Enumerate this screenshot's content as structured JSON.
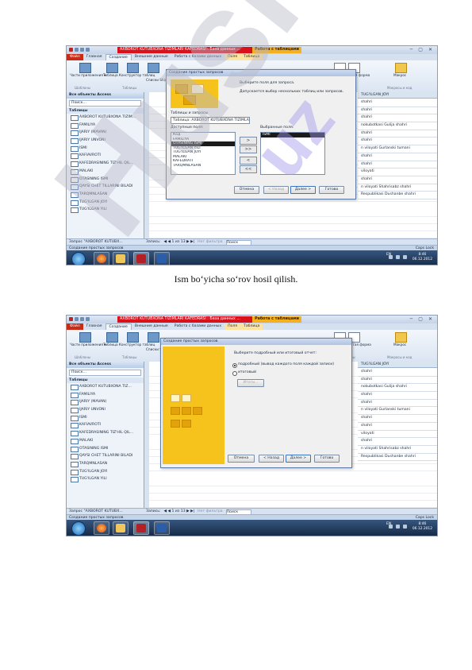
{
  "caption": "Ism bo‘yicha so‘rov hosil qilish.",
  "watermark": "Husnot",
  "watermark2": "uz",
  "shot1": {
    "title": "AXBOROT KUTUBXONA TIZIMLARI KAFEDRASI : База данных ...",
    "context_tab": "Работа с таблицами",
    "window_controls": [
      "─",
      "▢",
      "✕"
    ],
    "tabs": [
      "Файл",
      "Главная",
      "Создание",
      "Внешние данные",
      "Работа с базами данных",
      "Поля",
      "Таблица"
    ],
    "ribbon": {
      "b1": "Части приложения ▾",
      "b2": "Таблица Конструктор таблиц",
      "b3": "Списки SharePoint",
      "g1": "Шаблоны",
      "g2": "Таблицы",
      "b4": "Форма Пустая форма",
      "b5": "Макрос",
      "g3": "Формы",
      "g4": "Макросы и код"
    },
    "nav": {
      "header": "Все объекты Access",
      "search": "Поиск...",
      "section": "Таблицы",
      "items": [
        "AXBOROT KUTUBXONA TIZIM...",
        "FAMILIYA",
        "IJARIY (MAVAN)",
        "IJARIY UNVONI",
        "ISMI",
        "KAFIAVROTI",
        "KAFEDRASINING TIZ'HIL QIL...",
        "MALAKI",
        "OTASINING ISMI",
        "QAYSI CHET TILLARINI BILADI",
        "TARQMNLASAN",
        "TUG'ILGAN JOYI",
        "TUG'ILGAN YILI"
      ],
      "footer": "Запрос \"AXBOROT KUTUBX..."
    },
    "column_header": "TUG'ILGAN JOYI",
    "right_column": [
      "shahri",
      "shahri",
      "shahri",
      "nokubotkasi Gulija shahri",
      "shahri",
      "shahri",
      "n viloyati Gurlanski tumani",
      "shahri",
      "shahri",
      "viloyati",
      "shahri",
      "n viloyati Shahrisabz shahri",
      "Respublikasi Dushanbe shahri"
    ],
    "record_nav": {
      "label": "Запись:",
      "pos": "◀ ◀ 1 из 13 ▶ ▶|",
      "filter": "Нет фильтра",
      "search": "Поиск"
    },
    "status": "Создание простых запросов",
    "status_right": "Caps Lock",
    "clock": {
      "time": "8:46",
      "date": "06.12.2012"
    },
    "tray_lang": "EN",
    "dialog": {
      "title": "Создание простых запросов",
      "prompt1": "Выберите поля для запроса.",
      "prompt2": "Допускается выбор нескольких таблиц или запросов.",
      "tables_label": "Таблицы и запросы",
      "table_value": "Таблица: AXBOROT KUTUBXONA TIZIMLARI KAFEDRASI",
      "avail_label": "Доступные поля:",
      "avail_fields": [
        "Код",
        "FAMILIYA",
        "OTASINING ISMI",
        "TUG'ILGAN YILI",
        "TUG'ILGAN JOYI",
        "MALAKI",
        "KAFEDRATI",
        "TARQMNLASAN"
      ],
      "selected_label": "Выбранные поля:",
      "selected_fields": [
        "ISMI"
      ],
      "arrows": [
        ">",
        ">>",
        "<",
        "<<"
      ],
      "buttons": [
        "Отмена",
        "< Назад",
        "Далее >",
        "Готово"
      ]
    }
  },
  "shot2": {
    "title": "AXBOROT KUTUBXONA TIZIMLARI KAFEDRASI : База данных ...",
    "context_tab": "Работа с таблицами",
    "window_controls": [
      "─",
      "▢",
      "✕"
    ],
    "tabs": [
      "Файл",
      "Главная",
      "Создание",
      "Внешние данные",
      "Работа с базами данных",
      "Поля",
      "Таблица"
    ],
    "ribbon": {
      "b1": "Части приложения ▾",
      "b2": "Таблица Конструктор таблиц",
      "b3": "Списки SharePoint",
      "g1": "Шаблоны",
      "g2": "Таблицы",
      "b4": "Мастер Пустая форма",
      "b5": "Макрос",
      "g3": "Формы",
      "g4": "Макросы и код"
    },
    "nav": {
      "header": "Все объекты Access",
      "search": "Поиск...",
      "section": "Таблицы",
      "items": [
        "AXBOROT KUTUBXONA TIZ...",
        "FAMILIYA",
        "IJARIY (MAVAN)",
        "IJARIY UNVONI",
        "ISMI",
        "KAFIAVROTI",
        "KAFEDRASINING TIZ'HIL QIL...",
        "MALAKI",
        "OTASINING ISMI",
        "QAYSI CHET TILLARINI BILADI",
        "TARQMNLASAN",
        "TUG'ILGAN JOYI",
        "TUG'ILGAN YILI"
      ],
      "footer": "Запрос \"AXBOROT KUTUBX..."
    },
    "column_header": "TUG'ILGAN JOYI",
    "right_column": [
      "shahri",
      "shahri",
      "nokubotkasi Gulija shahri",
      "shahri",
      "shahri",
      "n viloyati Gurlanski tumani",
      "shahri",
      "shahri",
      "viloyati",
      "shahri",
      "n viloyati Shahrisabz shahri",
      "Respublikasi Dushanbe shahri"
    ],
    "record_nav": {
      "label": "Запись:",
      "pos": "◀ ◀ 1 из 13 ▶ ▶|",
      "filter": "Нет фильтра",
      "search": "Поиск"
    },
    "status": "Создание простых запросов",
    "status_right": "Caps Lock",
    "clock": {
      "time": "8:46",
      "date": "06.12.2012"
    },
    "tray_lang": "EN",
    "dialog": {
      "title": "Создание простых запросов",
      "prompt1": "Выберите подробный или итоговый отчет:",
      "radio1": "подробный (вывод каждого поля каждой записи)",
      "radio2": "итоговый",
      "totals_btn": "Итоги...",
      "buttons": [
        "Отмена",
        "< Назад",
        "Далее >",
        "Готово"
      ]
    }
  }
}
